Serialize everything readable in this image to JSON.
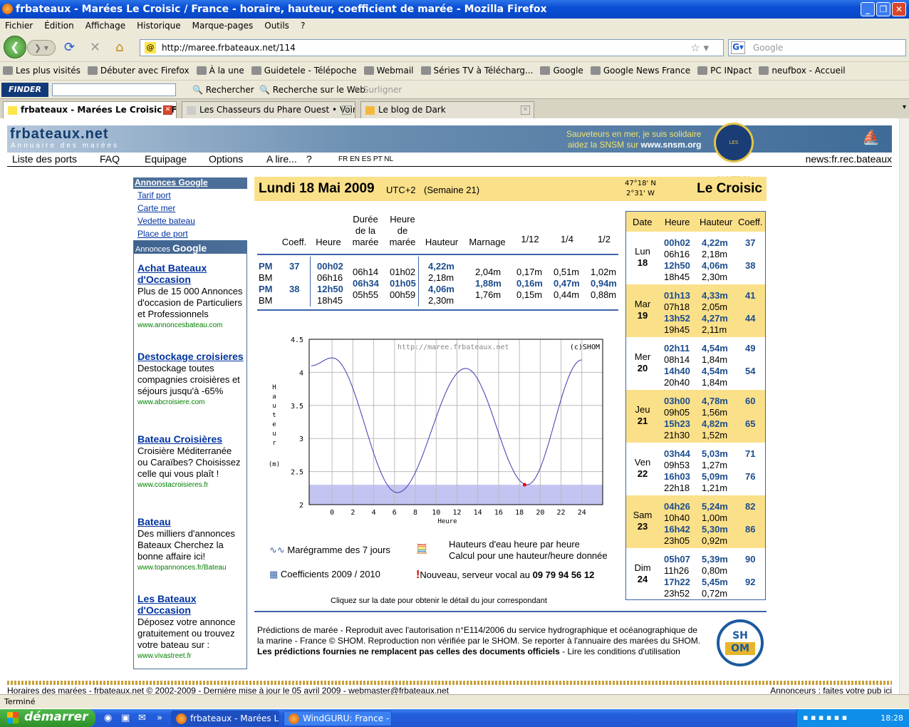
{
  "window": {
    "title": "frbateaux - Marées Le Croisic / France - horaire, hauteur, coefficient de marée - Mozilla Firefox"
  },
  "menu": [
    "Fichier",
    "Édition",
    "Affichage",
    "Historique",
    "Marque-pages",
    "Outils",
    "?"
  ],
  "nav": {
    "url": "http://maree.frbateaux.net/114",
    "search_placeholder": "Google"
  },
  "bookmarks": [
    "Les plus visités",
    "Débuter avec Firefox",
    "À la une",
    "Guidetele - Télépoche",
    "Webmail",
    "Séries TV à Télécharg...",
    "Google",
    "Google News France",
    "PC INpact",
    "neufbox - Accueil"
  ],
  "finder": {
    "logo": "FINDER",
    "search": "Rechercher",
    "web": "Recherche sur le Web",
    "highlight": "Surligner"
  },
  "tabs": [
    "frbateaux - Marées Le Croisic / F...",
    "Les Chasseurs du Phare Ouest • Voir le...",
    "Le blog de Dark"
  ],
  "site": {
    "brand": "frbateaux.net",
    "subtitle": "Annuaire des marées",
    "snsm1": "Sauveteurs en mer, je suis solidaire",
    "snsm2": "aidez la SNSM sur",
    "snsm_link": "www.snsm.org",
    "snsm_logo": "LES SAUVETEURS EN MER"
  },
  "topnav": {
    "items": [
      "Liste des ports",
      "FAQ",
      "Equipage",
      "Options",
      "A lire...",
      "?"
    ],
    "langs": "FR EN ES PT NL",
    "news": "news:fr.rec.bateaux"
  },
  "sidebar": {
    "head": "Annonces Google",
    "links": [
      "Tarif port",
      "Carte mer",
      "Vedette bateau",
      "Place de port"
    ],
    "ads_label": "Annonces",
    "ads_google": "Google",
    "ads": [
      {
        "title": "Achat Bateaux d'Occasion",
        "desc": "Plus de 15 000 Annonces d'occasion de Particuliers et Professionnels",
        "url": "www.annoncesbateau.com"
      },
      {
        "title": "Destockage croisieres",
        "desc": "Destockage toutes compagnies croisières et séjours jusqu'à -65%",
        "url": "www.abcroisiere.com"
      },
      {
        "title": "Bateau Croisières",
        "desc": "Croisière Méditerranée ou Caraïbes? Choisissez celle qui vous plaît !",
        "url": "www.costacroisieres.fr"
      },
      {
        "title": "Bateau",
        "desc": "Des milliers d'annonces Bateaux Cherchez la bonne affaire ici!",
        "url": "www.topannonces.fr/Bateau"
      },
      {
        "title": "Les Bateaux d'Occasion",
        "desc": "Déposez votre annonce gratuitement ou trouvez votre bateau sur :",
        "url": "www.vivastreet.fr"
      }
    ]
  },
  "main": {
    "date": "Lundi 18 Mai 2009",
    "tz": "UTC+2",
    "week": "(Semaine 21)",
    "lat": "47°18' N",
    "lon": "2°31' W",
    "city": "Le Croisic"
  },
  "table": {
    "headers": [
      "Coeff.",
      "Heure",
      "Durée de la marée",
      "Heure de marée",
      "Hauteur",
      "Marnage",
      "1/12",
      "1/4",
      "1/2"
    ],
    "types": [
      "PM",
      "BM",
      "PM",
      "BM"
    ],
    "coeffs": [
      "37",
      "",
      "38",
      ""
    ],
    "heures": [
      "00h02",
      "06h16",
      "12h50",
      "18h45"
    ],
    "durees": [
      "06h14",
      "06h34",
      "05h55"
    ],
    "heures_maree": [
      "01h02",
      "01h05",
      "00h59"
    ],
    "hauteurs": [
      "4,22m",
      "2,18m",
      "4,06m",
      "2,30m"
    ],
    "marnage": [
      "2,04m",
      "1,88m",
      "1,76m"
    ],
    "d12": [
      "0,17m",
      "0,16m",
      "0,15m"
    ],
    "d4": [
      "0,51m",
      "0,47m",
      "0,44m"
    ],
    "d2": [
      "1,02m",
      "0,94m",
      "0,88m"
    ]
  },
  "chart_data": {
    "type": "line",
    "title": "",
    "xlabel": "Heure",
    "ylabel": "Hauteur (m)",
    "xlim": [
      -2.2,
      26
    ],
    "ylim": [
      2,
      4.5
    ],
    "x_ticks": [
      0,
      2,
      4,
      6,
      8,
      10,
      12,
      14,
      16,
      18,
      20,
      22,
      24
    ],
    "y_ticks": [
      "2",
      "2.5",
      "3",
      "3.5",
      "4",
      "4.5"
    ],
    "watermark": "http://maree.frbateaux.net",
    "credit": "(c)SHOM",
    "series": [
      {
        "x": [
          -2,
          0.03,
          6.27,
          12.83,
          18.75,
          24
        ],
        "y": [
          4.1,
          4.22,
          2.18,
          4.06,
          2.3,
          4.19
        ]
      }
    ],
    "shaded_below": 2.3,
    "current_point": {
      "x": 18.5,
      "y": 2.3
    }
  },
  "legend": {
    "maregramme": "Marégramme des 7 jours",
    "hauteurs": "Hauteurs d'eau heure par heure",
    "calcul": "Calcul pour une hauteur/heure donnée",
    "coeffs": "Coefficients 2009 / 2010",
    "nouveau": "Nouveau, serveur vocal au",
    "phone": "09 79 94 56 12",
    "hint": "Cliquez sur la date pour obtenir le détail du jour correspondant"
  },
  "week": {
    "headers": [
      "Date",
      "Heure",
      "Hauteur",
      "Coeff."
    ],
    "days": [
      {
        "name": "Lun",
        "num": "18",
        "times": [
          "00h02",
          "06h16",
          "12h50",
          "18h45"
        ],
        "heights": [
          "4,22m",
          "2,18m",
          "4,06m",
          "2,30m"
        ],
        "coeffs": [
          "37",
          "38"
        ]
      },
      {
        "name": "Mar",
        "num": "19",
        "times": [
          "01h13",
          "07h18",
          "13h52",
          "19h45"
        ],
        "heights": [
          "4,33m",
          "2,05m",
          "4,27m",
          "2,11m"
        ],
        "coeffs": [
          "41",
          "44"
        ]
      },
      {
        "name": "Mer",
        "num": "20",
        "times": [
          "02h11",
          "08h14",
          "14h40",
          "20h40"
        ],
        "heights": [
          "4,54m",
          "1,84m",
          "4,54m",
          "1,84m"
        ],
        "coeffs": [
          "49",
          "54"
        ]
      },
      {
        "name": "Jeu",
        "num": "21",
        "times": [
          "03h00",
          "09h05",
          "15h23",
          "21h30"
        ],
        "heights": [
          "4,78m",
          "1,56m",
          "4,82m",
          "1,52m"
        ],
        "coeffs": [
          "60",
          "65"
        ]
      },
      {
        "name": "Ven",
        "num": "22",
        "times": [
          "03h44",
          "09h53",
          "16h03",
          "22h18"
        ],
        "heights": [
          "5,03m",
          "1,27m",
          "5,09m",
          "1,21m"
        ],
        "coeffs": [
          "71",
          "76"
        ]
      },
      {
        "name": "Sam",
        "num": "23",
        "times": [
          "04h26",
          "10h40",
          "16h42",
          "23h05"
        ],
        "heights": [
          "5,24m",
          "1,00m",
          "5,30m",
          "0,92m"
        ],
        "coeffs": [
          "82",
          "86"
        ]
      },
      {
        "name": "Dim",
        "num": "24",
        "times": [
          "05h07",
          "11h26",
          "17h22",
          "23h52"
        ],
        "heights": [
          "5,39m",
          "0,80m",
          "5,45m",
          "0,72m"
        ],
        "coeffs": [
          "90",
          "92"
        ]
      }
    ]
  },
  "footer": {
    "line1": "Prédictions de marée - Reproduit avec l'autorisation n°E114/2006 du service hydrographique et océanographique de",
    "line2": "la marine - France © SHOM.  Reproduction non vérifiée par le SHOM.  Se reporter à l'annuaire des marées du SHOM.",
    "bold": "Les prédictions fournies ne remplacent pas celles des documents officiels",
    "conditions": " -  Lire les conditions d'utilisation",
    "shom1": "SH",
    "shom2": "OM",
    "copyright": "Horaires des marées - frbateaux.net © 2002-2009 - Dernière mise à jour le 05 avril 2009 - webmaster@frbateaux.net",
    "annonceurs": "Annonceurs : faites votre pub ici"
  },
  "status": "Terminé",
  "taskbar": {
    "start": "démarrer",
    "tasks": [
      "frbateaux - Marées L...",
      "WindGURU: France - ..."
    ],
    "clock": "18:28"
  }
}
